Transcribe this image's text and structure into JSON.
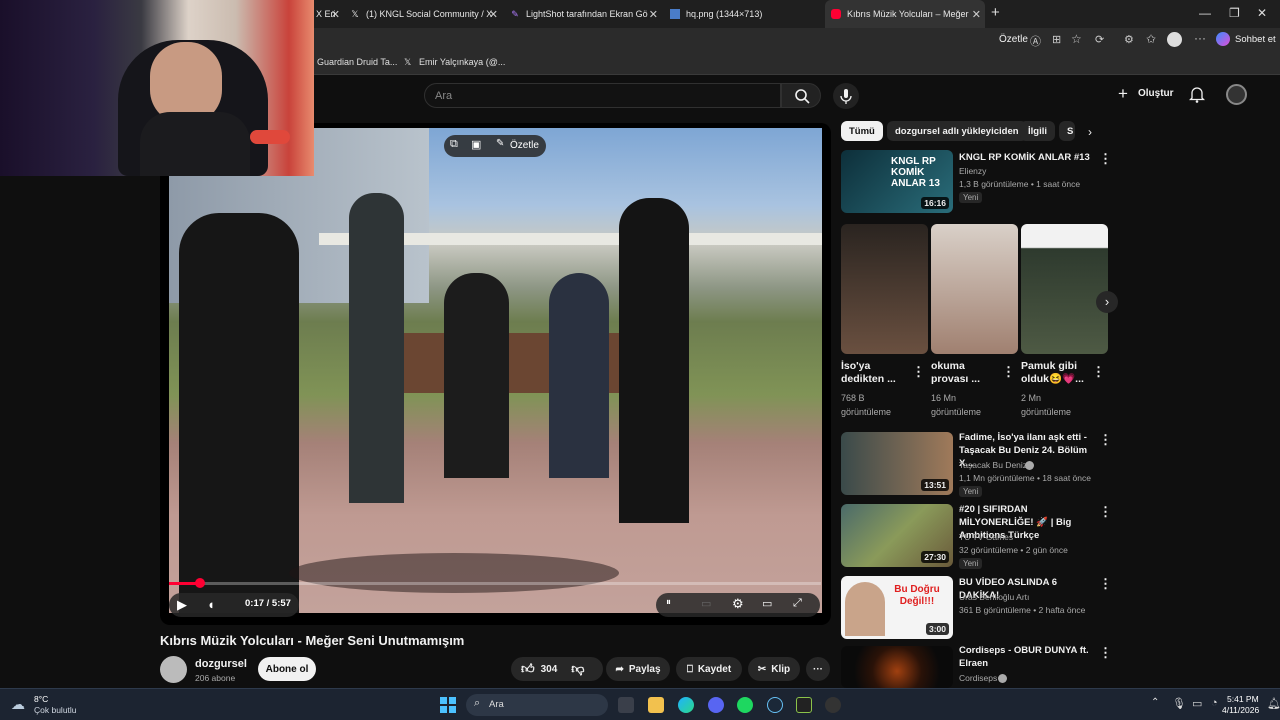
{
  "browser": {
    "tabs": [
      {
        "label": "X Eri",
        "icon": "x-icon"
      },
      {
        "label": "(1) KNGL Social Community / X",
        "icon": "x-icon"
      },
      {
        "label": "LightShot tarafından Ekran Görüntü",
        "icon": "feather-icon"
      },
      {
        "label": "hq.png (1344×713)",
        "icon": "image-icon"
      },
      {
        "label": "Kıbrıs Müzik Yolcuları – Meğer Sen",
        "icon": "youtube-icon"
      }
    ],
    "summarize_label": "Özetle",
    "profile_label": "Sohbet et",
    "bookmarks": [
      {
        "label": "Guardian Druid Ta..."
      },
      {
        "label": "Emir Yalçınkaya (@..."
      }
    ]
  },
  "youtube": {
    "search_placeholder": "Ara",
    "create_label": "Oluştur",
    "player": {
      "overlay_summarize": "Özetle",
      "time": "0:17 / 5:57",
      "progress": 0.048
    },
    "video_title": "Kıbrıs Müzik Yolcuları - Meğer Seni Unutmamışım",
    "channel": {
      "name": "dozgursel",
      "subs": "206 abone",
      "subscribe_label": "Abone ol"
    },
    "actions": {
      "likes": "304",
      "share": "Paylaş",
      "save": "Kaydet",
      "clip": "Klip"
    },
    "chips": [
      "Tümü",
      "dozgursel adlı yükleyiciden",
      "İlgili",
      "S"
    ],
    "videos": [
      {
        "title": "KNGL RP KOMİK ANLAR #13",
        "channel": "Elienzy",
        "meta": "1,3 B görüntüleme • 1 saat önce",
        "badge": "Yeni",
        "duration": "16:16",
        "thumb_text": "KNGL RP KOMİK ANLAR 13"
      },
      {
        "title": "Fadime, İso'ya ilanı aşk etti - Taşacak Bu Deniz 24. Bölüm X...",
        "channel": "Taşacak Bu Deniz",
        "meta": "1,1 Mn görüntüleme • 18 saat önce",
        "badge": "Yeni",
        "duration": "13:51"
      },
      {
        "title": "#20 | SIFIRDAN MİLYONERLİĞE! 🚀 | Big Ambitions Türkçe",
        "channel": "TU TV Games",
        "meta": "32 görüntüleme • 2 gün önce",
        "badge": "Yeni",
        "duration": "27:30"
      },
      {
        "title": "BU VİDEO ASLINDA 6 DAKİKA!",
        "channel": "Uras Benlioğlu Artı",
        "meta": "361 B görüntüleme • 2 hafta önce",
        "duration": "3:00",
        "thumb_text": "Bu Doğru Değil!!!"
      },
      {
        "title": "Cordiseps - OBUR DUNYA ft. Elraen",
        "channel": "Cordiseps",
        "meta": ""
      }
    ],
    "shorts": [
      {
        "title": "İso'ya dedikten ...",
        "views": "768 B görüntüleme"
      },
      {
        "title": "okuma provası ...",
        "views": "16 Mn görüntüleme"
      },
      {
        "title": "Pamuk gibi olduk😆💗...",
        "views": "2 Mn görüntüleme"
      }
    ]
  },
  "taskbar": {
    "weather_temp": "8°C",
    "weather_desc": "Çok bulutlu",
    "search_label": "Ara",
    "time": "5:41 PM",
    "date": "4/11/2026"
  }
}
